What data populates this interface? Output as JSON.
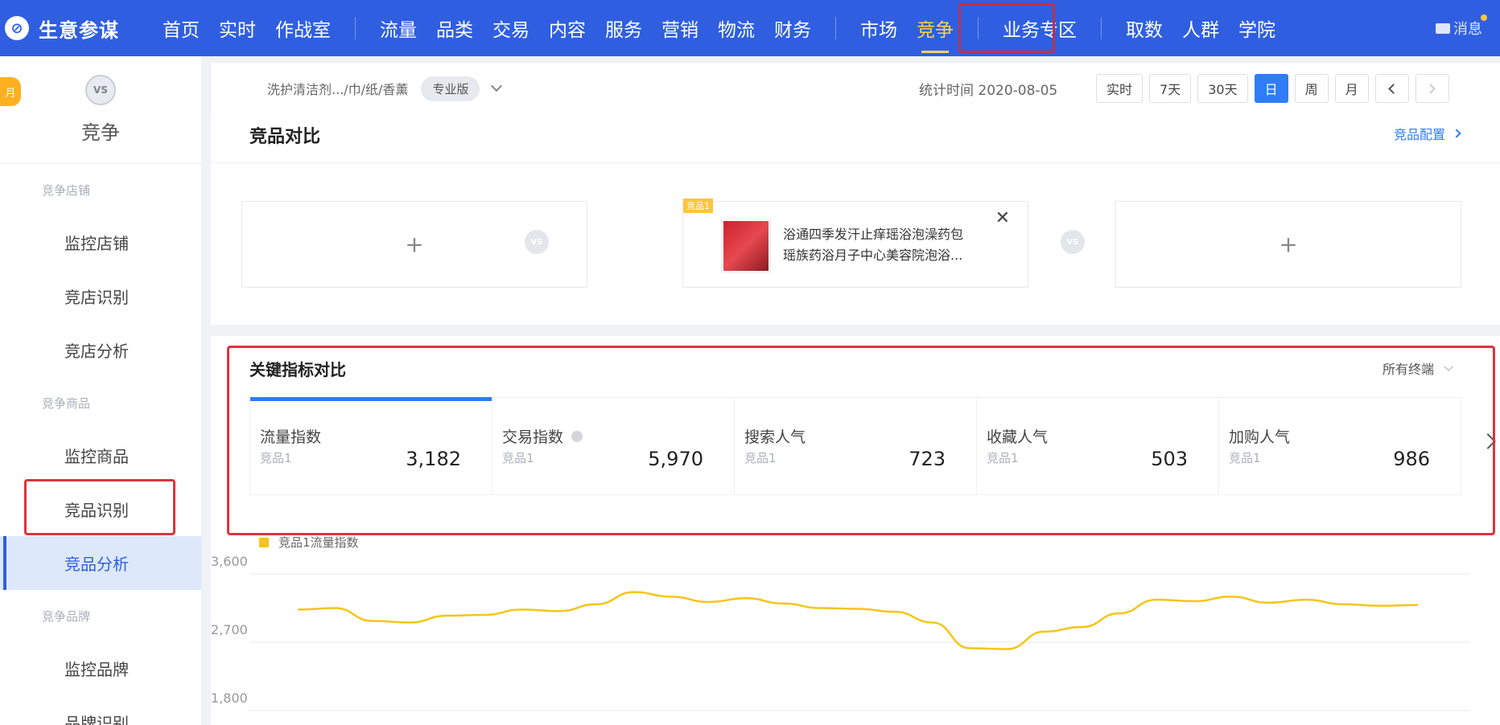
{
  "brand": {
    "logo": "compass-icon",
    "name": "生意参谋"
  },
  "nav": {
    "group1": [
      "首页",
      "实时",
      "作战室"
    ],
    "group2": [
      "流量",
      "品类",
      "交易",
      "内容",
      "服务",
      "营销",
      "物流",
      "财务"
    ],
    "group3": [
      "市场",
      "竞争"
    ],
    "group4": [
      "业务专区"
    ],
    "group5": [
      "取数",
      "人群",
      "学院"
    ],
    "active": "竞争",
    "message": "消息"
  },
  "sidebar": {
    "tag": "月",
    "title": "竞争",
    "vs": "VS",
    "groups": [
      {
        "label": "竞争店铺",
        "items": [
          "监控店铺",
          "竞店识别",
          "竞店分析"
        ]
      },
      {
        "label": "竞争商品",
        "items": [
          "监控商品",
          "竞品识别",
          "竞品分析"
        ]
      },
      {
        "label": "竞争品牌",
        "items": [
          "监控品牌",
          "品牌识别"
        ]
      }
    ],
    "active": "竞品分析"
  },
  "filter": {
    "category": "洗护清洁剂.../巾/纸/香薰",
    "edition": "专业版",
    "stat_time": "统计时间 2020-08-05",
    "periods": [
      "实时",
      "7天",
      "30天",
      "日",
      "周",
      "月"
    ],
    "active_period": "日"
  },
  "compare": {
    "title": "竞品对比",
    "config_link": "竞品配置",
    "plus": "+",
    "vs": "VS",
    "product": {
      "badge": "竞品1",
      "title_line1": "浴通四季发汗止痒瑶浴泡澡药包",
      "title_line2": "瑶族药浴月子中心美容院泡浴..."
    }
  },
  "metrics": {
    "title": "关键指标对比",
    "terminal": "所有终端",
    "items": [
      {
        "label": "流量指数",
        "sub": "竞品1",
        "value": "3,182"
      },
      {
        "label": "交易指数",
        "sub": "竞品1",
        "value": "5,970"
      },
      {
        "label": "搜索人气",
        "sub": "竞品1",
        "value": "723"
      },
      {
        "label": "收藏人气",
        "sub": "竞品1",
        "value": "503"
      },
      {
        "label": "加购人气",
        "sub": "竞品1",
        "value": "986"
      }
    ]
  },
  "chart_data": {
    "type": "line",
    "series": [
      {
        "name": "竞品1流量指数",
        "color": "#f5c518",
        "values": [
          3130,
          3150,
          2980,
          2960,
          3050,
          3060,
          3130,
          3110,
          3200,
          3360,
          3300,
          3230,
          3280,
          3210,
          3150,
          3140,
          3100,
          2960,
          2620,
          2610,
          2840,
          2900,
          3080,
          3260,
          3240,
          3300,
          3220,
          3260,
          3200,
          3180,
          3190
        ]
      }
    ],
    "y_ticks": [
      "3,600",
      "2,700",
      "1,800"
    ],
    "ylim": [
      1800,
      3600
    ],
    "grid": true,
    "legend": "top-left"
  },
  "colors": {
    "nav_bg": "#2f5fe0",
    "accent": "#2f7cf6",
    "active_nav": "#ffd34d",
    "highlight": "#d9363e"
  }
}
